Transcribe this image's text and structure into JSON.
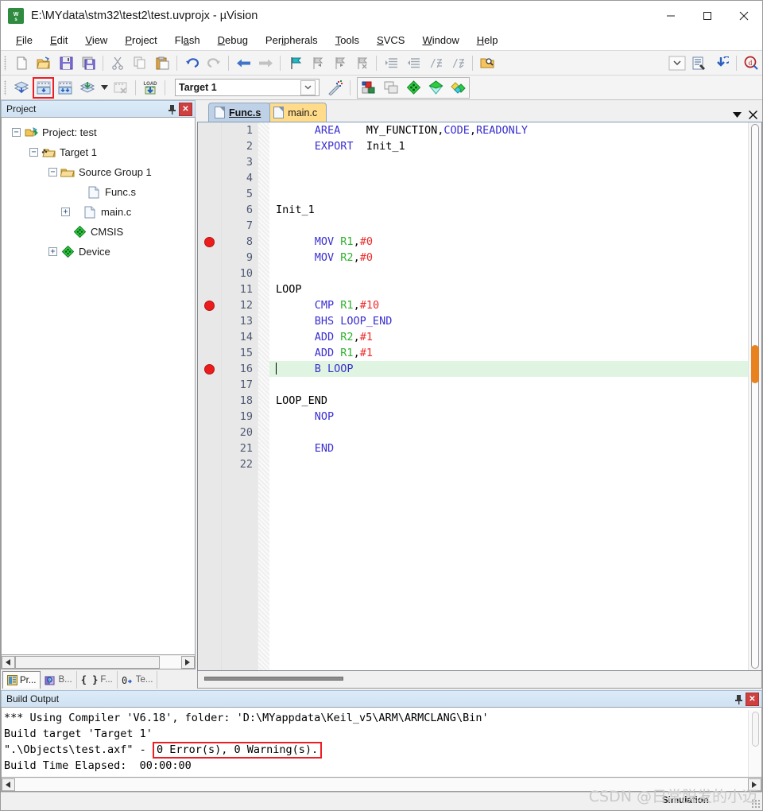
{
  "window": {
    "title": "E:\\MYdata\\stm32\\test2\\test.uvprojx - µVision",
    "app_icon": "uvision-logo-icon",
    "minimize": "—",
    "maximize": "☐",
    "close": "✕"
  },
  "menu": {
    "items": [
      {
        "label": "File",
        "accel": "F"
      },
      {
        "label": "Edit",
        "accel": "E"
      },
      {
        "label": "View",
        "accel": "V"
      },
      {
        "label": "Project",
        "accel": "P"
      },
      {
        "label": "Flash",
        "accel": "a"
      },
      {
        "label": "Debug",
        "accel": "D"
      },
      {
        "label": "Peripherals",
        "accel": "i"
      },
      {
        "label": "Tools",
        "accel": "T"
      },
      {
        "label": "SVCS",
        "accel": "S"
      },
      {
        "label": "Window",
        "accel": "W"
      },
      {
        "label": "Help",
        "accel": "H"
      }
    ]
  },
  "toolbar_main": {
    "buttons": [
      "new-file-icon",
      "open-file-icon",
      "save-icon",
      "save-all-icon",
      "cut-icon",
      "copy-icon",
      "paste-icon",
      "undo-icon",
      "redo-icon",
      "back-icon",
      "forward-icon",
      "bookmark-toggle-icon",
      "bookmark-prev-icon",
      "bookmark-next-icon",
      "bookmark-clear-icon",
      "indent-icon",
      "outdent-icon",
      "comment-icon",
      "uncomment-icon",
      "find-in-files-icon"
    ],
    "right_buttons": [
      "dropdown-icon",
      "configure-icon",
      "download-icon",
      "debug-start-icon"
    ]
  },
  "toolbar_build": {
    "translate_label": "translate-icon",
    "build_label": "build-icon",
    "rebuild_label": "rebuild-icon",
    "batch_build_label": "batch-build-icon",
    "stop_build_label": "stop-build-icon",
    "download_label": "load-icon",
    "target_name": "Target 1",
    "target_dropdown": "chevron-down-icon",
    "magic_wand": "options-for-target-icon",
    "debug_buttons": [
      "components-icon",
      "windows-icon",
      "green-diamond-icon",
      "teal-diamond-icon",
      "multi-diamond-icon"
    ],
    "highlighted_button": "build-icon"
  },
  "project_panel": {
    "title": "Project",
    "pin_icon": "pin-icon",
    "close_icon": "close-icon",
    "tree": [
      {
        "label": "Project: test",
        "depth": 0,
        "expander": "-",
        "icon": "project-icon"
      },
      {
        "label": "Target 1",
        "depth": 1,
        "expander": "-",
        "icon": "target-icon"
      },
      {
        "label": "Source Group 1",
        "depth": 2,
        "expander": "-",
        "icon": "folder-icon"
      },
      {
        "label": "Func.s",
        "depth": 3,
        "expander": "",
        "icon": "file-icon"
      },
      {
        "label": "main.c",
        "depth": 3,
        "expander": "+",
        "icon": "file-icon"
      },
      {
        "label": "CMSIS",
        "depth": 2,
        "expander": "",
        "icon": "green-diamond-icon"
      },
      {
        "label": "Device",
        "depth": 2,
        "expander": "+",
        "icon": "green-diamond-icon"
      }
    ],
    "tabs": [
      {
        "label": "Pr...",
        "icon": "project-tab-icon",
        "active": true
      },
      {
        "label": "B...",
        "icon": "books-tab-icon",
        "active": false
      },
      {
        "label": "F...",
        "icon": "functions-tab-icon",
        "active": false
      },
      {
        "label": "Te...",
        "icon": "templates-tab-icon",
        "active": false
      }
    ],
    "scroll_left": "◀",
    "scroll_right": "▶"
  },
  "editor": {
    "tabs": [
      {
        "label": "Func.s",
        "active": true
      },
      {
        "label": "main.c",
        "active": false
      }
    ],
    "tab_dropdown": "▼",
    "tab_close": "✕",
    "current_line": 16,
    "breakpoint_lines": [
      8,
      12,
      16
    ],
    "lines": [
      {
        "num": 1,
        "indent": 6,
        "tokens": [
          {
            "t": "AREA",
            "c": "k"
          },
          {
            "t": "    MY_FUNCTION,",
            "c": "lb"
          },
          {
            "t": "CODE",
            "c": "b"
          },
          {
            "t": ",",
            "c": "lb"
          },
          {
            "t": "READONLY",
            "c": "b"
          }
        ]
      },
      {
        "num": 2,
        "indent": 6,
        "tokens": [
          {
            "t": "EXPORT  ",
            "c": "k"
          },
          {
            "t": "Init_1",
            "c": "lb"
          }
        ]
      },
      {
        "num": 3,
        "indent": 0,
        "tokens": []
      },
      {
        "num": 4,
        "indent": 0,
        "tokens": []
      },
      {
        "num": 5,
        "indent": 0,
        "tokens": []
      },
      {
        "num": 6,
        "indent": 0,
        "tokens": [
          {
            "t": "Init_1",
            "c": "lb"
          }
        ]
      },
      {
        "num": 7,
        "indent": 0,
        "tokens": []
      },
      {
        "num": 8,
        "indent": 6,
        "tokens": [
          {
            "t": "MOV ",
            "c": "k"
          },
          {
            "t": "R1",
            "c": "r"
          },
          {
            "t": ",",
            "c": "lb"
          },
          {
            "t": "#0",
            "c": "n"
          }
        ]
      },
      {
        "num": 9,
        "indent": 6,
        "tokens": [
          {
            "t": "MOV ",
            "c": "k"
          },
          {
            "t": "R2",
            "c": "r"
          },
          {
            "t": ",",
            "c": "lb"
          },
          {
            "t": "#0",
            "c": "n"
          }
        ]
      },
      {
        "num": 10,
        "indent": 0,
        "tokens": []
      },
      {
        "num": 11,
        "indent": 0,
        "tokens": [
          {
            "t": "LOOP",
            "c": "lb"
          }
        ]
      },
      {
        "num": 12,
        "indent": 6,
        "tokens": [
          {
            "t": "CMP ",
            "c": "k"
          },
          {
            "t": "R1",
            "c": "r"
          },
          {
            "t": ",",
            "c": "lb"
          },
          {
            "t": "#10",
            "c": "n"
          }
        ]
      },
      {
        "num": 13,
        "indent": 6,
        "tokens": [
          {
            "t": "BHS ",
            "c": "k"
          },
          {
            "t": "LOOP_END",
            "c": "b"
          }
        ]
      },
      {
        "num": 14,
        "indent": 6,
        "tokens": [
          {
            "t": "ADD ",
            "c": "k"
          },
          {
            "t": "R2",
            "c": "r"
          },
          {
            "t": ",",
            "c": "lb"
          },
          {
            "t": "#1",
            "c": "n"
          }
        ]
      },
      {
        "num": 15,
        "indent": 6,
        "tokens": [
          {
            "t": "ADD ",
            "c": "k"
          },
          {
            "t": "R1",
            "c": "r"
          },
          {
            "t": ",",
            "c": "lb"
          },
          {
            "t": "#1",
            "c": "n"
          }
        ]
      },
      {
        "num": 16,
        "indent": 6,
        "tokens": [
          {
            "t": "B ",
            "c": "k"
          },
          {
            "t": "LOOP",
            "c": "b"
          }
        ]
      },
      {
        "num": 17,
        "indent": 0,
        "tokens": []
      },
      {
        "num": 18,
        "indent": 0,
        "tokens": [
          {
            "t": "LOOP_END",
            "c": "lb"
          }
        ]
      },
      {
        "num": 19,
        "indent": 6,
        "tokens": [
          {
            "t": "NOP",
            "c": "k"
          }
        ]
      },
      {
        "num": 20,
        "indent": 0,
        "tokens": []
      },
      {
        "num": 21,
        "indent": 6,
        "tokens": [
          {
            "t": "END",
            "c": "k"
          }
        ]
      },
      {
        "num": 22,
        "indent": 0,
        "tokens": []
      }
    ]
  },
  "build_output": {
    "title": "Build Output",
    "pin_icon": "pin-icon",
    "close_icon": "close-icon",
    "lines": [
      {
        "pre": "*** Using Compiler 'V6.18', folder: 'D:\\MYappdata\\Keil_v5\\ARM\\ARMCLANG\\Bin'",
        "hl": "",
        "post": ""
      },
      {
        "pre": "Build target 'Target 1'",
        "hl": "",
        "post": ""
      },
      {
        "pre": "\".\\Objects\\test.axf\" - ",
        "hl": "0 Error(s), 0 Warning(s).",
        "post": ""
      },
      {
        "pre": "Build Time Elapsed:  00:00:00",
        "hl": "",
        "post": ""
      }
    ],
    "scroll_left": "◀",
    "scroll_right": "▶"
  },
  "statusbar": {
    "simulation": "Simulation"
  },
  "watermark": {
    "text": "CSDN @日常脱发的小迈"
  },
  "colors": {
    "accent_red": "#ee1c25",
    "keyword_blue": "#3a2fd0",
    "register_green": "#2fb02f",
    "number_red": "#ee2b2b",
    "current_line": "#dff5e2",
    "scrollbar_orange": "#e8821e",
    "tab_active": "#bed1e6",
    "tab_inactive": "#ffdb8a"
  }
}
